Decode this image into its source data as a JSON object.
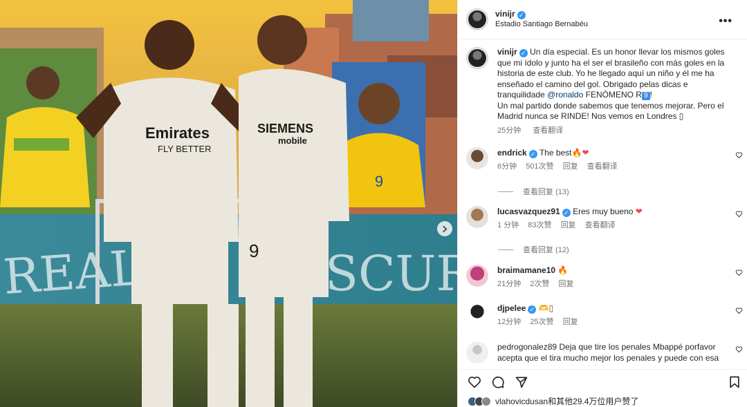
{
  "post": {
    "username": "vinijr",
    "location": "Estadio Santiago Bernabéu",
    "more_icon": "more-horizontal-icon"
  },
  "caption": {
    "username": "vinijr",
    "text_1": "Un día especial. Es un honor llevar los mismos goles que mi ídolo y junto ha el ser el brasileño con más goles en la historia de este club. Yo he llegado aquí un niño y él me ha enseñado el camino del gol. Obrigado pelas dicas e tranquilidade ",
    "mention": "@ronaldo",
    "text_2": " FENÓMENO R",
    "emoji_nine": "9",
    "text_3": "!",
    "text_4": "Un mal partido donde sabemos que tenemos mejorar. Pero el Madrid nunca se RINDE! Nos vemos en Londres ",
    "emoji_end": "▯",
    "time": "25分钟",
    "translate": "查看翻译"
  },
  "comments": [
    {
      "username": "endrick",
      "verified": true,
      "text": "The best",
      "emoji": "🔥❤",
      "time": "6分钟",
      "likes": "501次赞",
      "reply": "回复",
      "translate": "查看翻译",
      "view_replies": "查看回复 (13)"
    },
    {
      "username": "lucasvazquez91",
      "verified": true,
      "text": "Eres muy bueno",
      "emoji": "❤",
      "time": "1 分钟",
      "likes": "83次赞",
      "reply": "回复",
      "translate": "查看翻译",
      "view_replies": "查看回复 (12)"
    },
    {
      "username": "braimamane10",
      "verified": false,
      "text": "",
      "emoji": "🔥",
      "time": "21分钟",
      "likes": "2次赞",
      "reply": "回复"
    },
    {
      "username": "djpelee",
      "verified": true,
      "text": "",
      "emoji": "🫶▯",
      "time": "12分钟",
      "likes": "25次赞",
      "reply": "回复"
    },
    {
      "username": "pedrogonalez89",
      "verified": false,
      "text": "Deja que tire los penales Mbappé porfavor acepta que el tira mucho mejor los penales y puede con esa"
    }
  ],
  "likes": {
    "text_user": "vlahovicdusan",
    "text_rest": "和其他29.4万位用户赞了"
  },
  "colors": {
    "verified": "#3897f0",
    "mention": "#00376b",
    "heart_red": "#ed4956",
    "muted": "#737373"
  }
}
